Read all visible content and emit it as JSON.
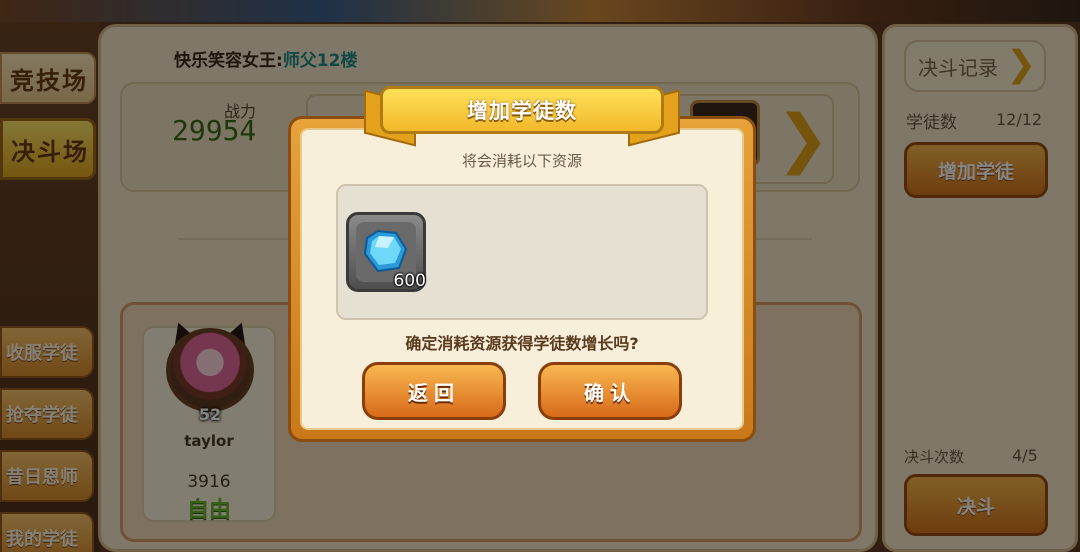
{
  "sidebar": {
    "tabs": [
      {
        "label": "竞技场"
      },
      {
        "label": "决斗场"
      }
    ],
    "buttons": [
      {
        "label": "收服学徒"
      },
      {
        "label": "抢夺学徒"
      },
      {
        "label": "昔日恩师"
      },
      {
        "label": "我的学徒"
      }
    ]
  },
  "header": {
    "player_name": "快乐笑容女王",
    "separator": ":",
    "master_title": "师父12楼"
  },
  "power": {
    "label": "战力",
    "value": "29954"
  },
  "disciple_card": {
    "level": "52",
    "name": "taylor",
    "value": "3916",
    "status": "自由"
  },
  "right_panel": {
    "record_button": "决斗记录",
    "disciples_label": "学徒数",
    "disciples_value": "12/12",
    "add_disciple_button": "增加学徒",
    "duel_count_label": "决斗次数",
    "duel_count_value": "4/5",
    "duel_button": "决斗"
  },
  "modal": {
    "title": "增加学徒数",
    "subtitle": "将会消耗以下资源",
    "resource_icon": "blue-gem-icon",
    "resource_quantity": "600",
    "question": "确定消耗资源获得学徒数增长吗?",
    "back_button": "返回",
    "confirm_button": "确认"
  },
  "colors": {
    "modal_frame": "#e7a23a",
    "ribbon": "#f2b82a",
    "button": "#d86a1a",
    "gem": "#4fc3f0",
    "status_free": "#6ab62a"
  }
}
